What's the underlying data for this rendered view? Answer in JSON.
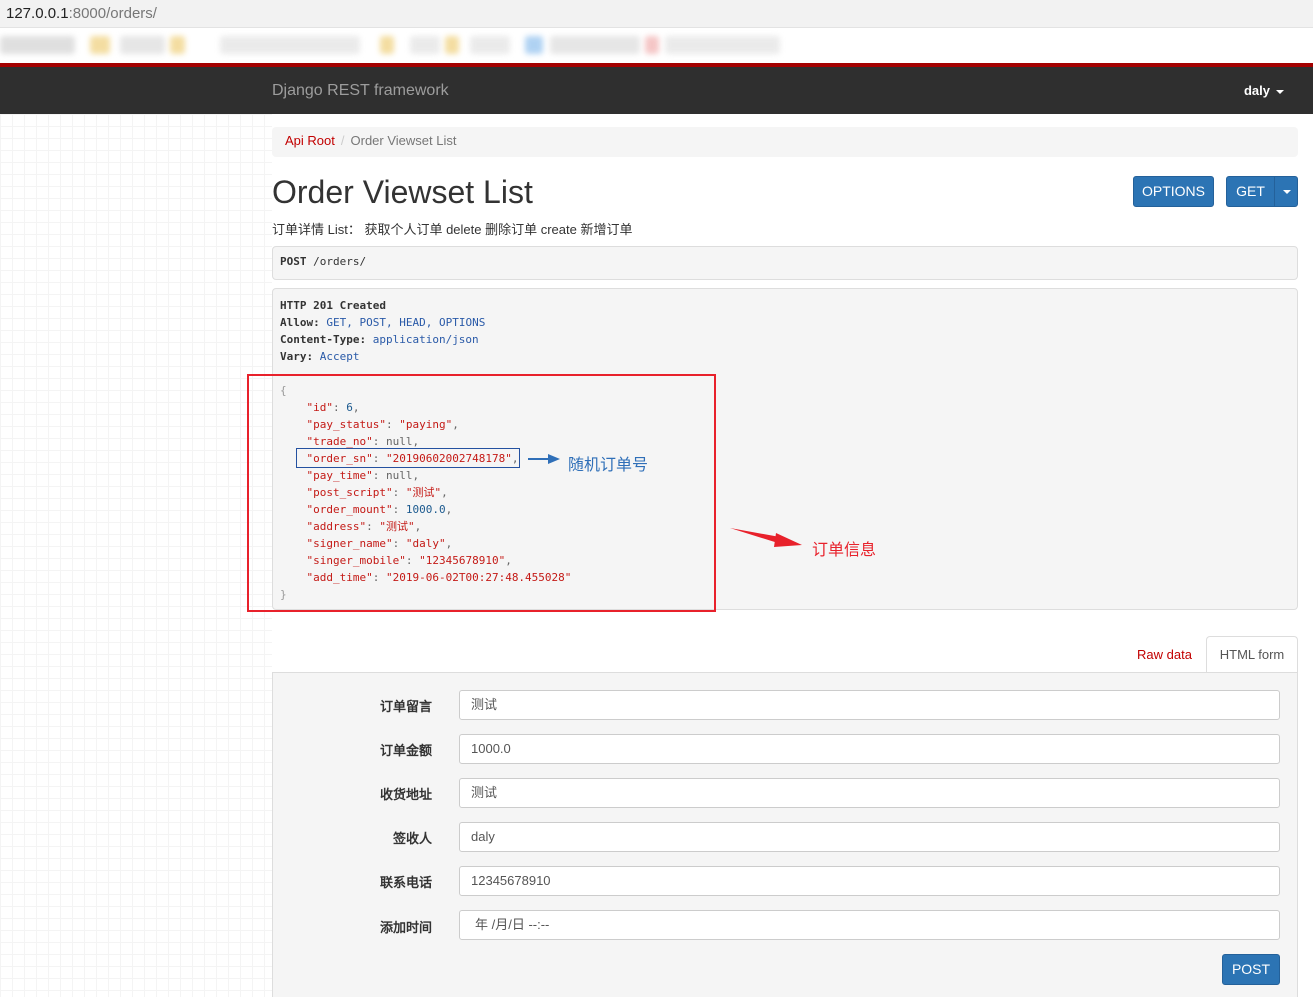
{
  "browser": {
    "url_host": "127.0.0.1",
    "url_rest": ":8000/orders/"
  },
  "navbar": {
    "brand": "Django REST framework",
    "user": "daly"
  },
  "breadcrumb": {
    "root": "Api Root",
    "separator": "/",
    "current": "Order Viewset List"
  },
  "page": {
    "title": "Order Viewset List",
    "description": "订单详情 List：  获取个人订单 delete 删除订单 create 新增订单"
  },
  "buttons": {
    "options": "OPTIONS",
    "get": "GET",
    "post": "POST"
  },
  "request": {
    "method": "POST",
    "path": "/orders/"
  },
  "response": {
    "status": "HTTP 201 Created",
    "headers": [
      {
        "key": "Allow:",
        "value": "GET, POST, HEAD, OPTIONS"
      },
      {
        "key": "Content-Type:",
        "value": "application/json"
      },
      {
        "key": "Vary:",
        "value": "Accept"
      }
    ],
    "json_lines": [
      {
        "indent": "",
        "key": "",
        "value": "{",
        "type": "brace",
        "trail": ""
      },
      {
        "indent": "    ",
        "key": "\"id\"",
        "value": "6",
        "type": "num",
        "trail": ","
      },
      {
        "indent": "    ",
        "key": "\"pay_status\"",
        "value": "\"paying\"",
        "type": "str",
        "trail": ","
      },
      {
        "indent": "    ",
        "key": "\"trade_no\"",
        "value": "null",
        "type": "plain",
        "trail": ","
      },
      {
        "indent": "    ",
        "key": "\"order_sn\"",
        "value": "\"20190602002748178\"",
        "type": "str",
        "trail": ","
      },
      {
        "indent": "    ",
        "key": "\"pay_time\"",
        "value": "null",
        "type": "plain",
        "trail": ","
      },
      {
        "indent": "    ",
        "key": "\"post_script\"",
        "value": "\"测试\"",
        "type": "str",
        "trail": ","
      },
      {
        "indent": "    ",
        "key": "\"order_mount\"",
        "value": "1000.0",
        "type": "num",
        "trail": ","
      },
      {
        "indent": "    ",
        "key": "\"address\"",
        "value": "\"测试\"",
        "type": "str",
        "trail": ","
      },
      {
        "indent": "    ",
        "key": "\"signer_name\"",
        "value": "\"daly\"",
        "type": "str",
        "trail": ","
      },
      {
        "indent": "    ",
        "key": "\"singer_mobile\"",
        "value": "\"12345678910\"",
        "type": "str",
        "trail": ","
      },
      {
        "indent": "    ",
        "key": "\"add_time\"",
        "value": "\"2019-06-02T00:27:48.455028\"",
        "type": "str",
        "trail": ""
      },
      {
        "indent": "",
        "key": "",
        "value": "}",
        "type": "brace",
        "trail": ""
      }
    ]
  },
  "annotations": {
    "order_sn_note": "随机订单号",
    "order_info_note": "订单信息",
    "colors": {
      "red": "#e8212b",
      "blue": "#2f6fb8"
    }
  },
  "tabs": {
    "raw": "Raw data",
    "html": "HTML form"
  },
  "form": {
    "fields": [
      {
        "label": "订单留言",
        "value": "测试"
      },
      {
        "label": "订单金额",
        "value": "1000.0"
      },
      {
        "label": "收货地址",
        "value": "测试"
      },
      {
        "label": "签收人",
        "value": "daly"
      },
      {
        "label": "联系电话",
        "value": "12345678910"
      },
      {
        "label": "添加时间",
        "value": "年 /月/日 --:--"
      }
    ]
  }
}
